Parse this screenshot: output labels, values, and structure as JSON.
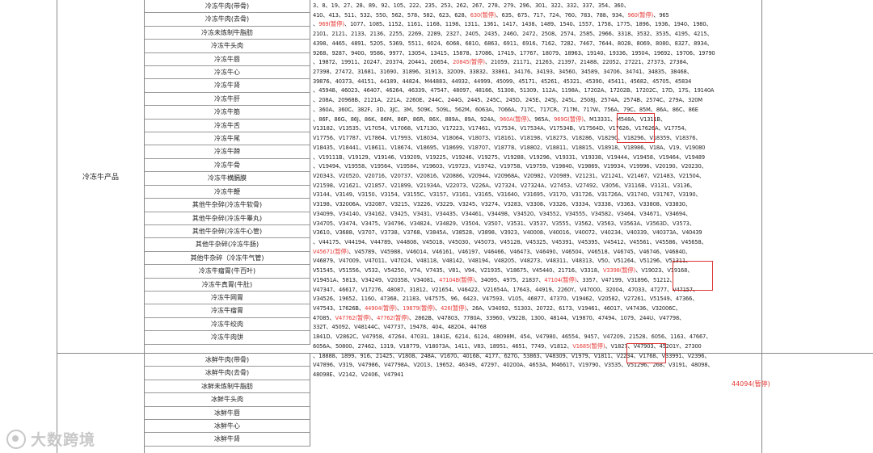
{
  "frozen": {
    "category": "冷冻牛产品",
    "items": [
      "冷冻牛肉(带骨)",
      "冷冻牛肉(去骨)",
      "冷冻未炼制牛脂肪",
      "冷冻牛头肉",
      "冷冻牛唇",
      "冷冻牛心",
      "冷冻牛肾",
      "冷冻牛肝",
      "冷冻牛筋",
      "冷冻牛舌",
      "冷冻牛尾",
      "冷冻牛蹄",
      "冷冻牛骨",
      "冷冻牛横膈膜",
      "冷冻牛鞭",
      "其他牛杂碎(冷冻牛软骨)",
      "其他牛杂碎(冷冻牛睾丸)",
      "其他牛杂碎(冷冻牛心管)",
      "其他牛杂碎(冷冻牛肠)",
      "其他牛杂碎（冷冻牛气管)",
      "冷冻牛瘤胃(牛百叶)",
      "冷冻牛真胃(牛肚)",
      "冷冻牛网胃",
      "冷冻牛瘤胃",
      "冷冻牛绞肉",
      "冷冻牛肉饼"
    ]
  },
  "fresh": {
    "items": [
      "冰鲜牛肉(带骨)",
      "冰鲜牛肉(去骨)",
      "冰鲜未炼制牛脂肪",
      "冰鲜牛头肉",
      "冰鲜牛唇",
      "冰鲜牛心",
      "冰鲜牛肾"
    ]
  },
  "codes_lines": [
    [
      {
        "t": "3、8、19、27、28、89、92、105、222、235、253、262、267、278、279、296、301、322、332、337、354、360、"
      }
    ],
    [
      {
        "t": "410、413、511、532、550、562、578、582、623、628、"
      },
      {
        "t": "630(暂停)",
        "r": 1
      },
      {
        "t": "、635、675、717、724、760、783、788、934、"
      },
      {
        "t": "960(暂停)",
        "r": 1
      },
      {
        "t": "、965"
      }
    ],
    [
      {
        "t": "、"
      },
      {
        "t": "969(暂停)",
        "r": 1
      },
      {
        "t": "、1077、1085、1152、1161、1168、1198、1311、1361、1417、1438、1489、1540、1557、1758、1775、1896、1936、1940、1980、"
      }
    ],
    [
      {
        "t": "2101、2121、2133、2136、2255、2269、2289、2327、2405、2435、2460、2472、2508、2574、2585、2966、3318、3532、3535、4195、4215、"
      }
    ],
    [
      {
        "t": "4398、4465、4891、5205、5369、5511、6024、6068、6810、6863、6911、6916、7162、7282、7467、7644、8028、8069、8080、8327、8934、"
      }
    ],
    [
      {
        "t": "9268、9287、9400、9586、9977、13054、13415、15878、17086、17419、17767、18079、18963、19140、19336、19504、19692、19706、19790"
      }
    ],
    [
      {
        "t": "、19872、19911、20247、20374、20441、20654、"
      },
      {
        "t": "20845(暂停)",
        "r": 1
      },
      {
        "t": "、21059、21171、21263、21397、21488、22052、27221、27373、27384、"
      }
    ],
    [
      {
        "t": "27398、27472、31681、31690、31896、31913、32009、33832、33861、34176、34193、34560、34589、34706、34741、34835、38468、"
      }
    ],
    [
      {
        "t": "39876、40373、44151、44189、44824、M44883、44932、44999、45099、45171、45261、45321、45390、45411、45682、45705、45834"
      }
    ],
    [
      {
        "t": "、45948、46023、46407、46264、46339、47547、48097、48166、51308、51309、112A、1198A、17202A、17202B、17202C、17D、17S、19140A"
      }
    ],
    [
      {
        "t": "、208A、20968B、2121A、221A、2260E、244C、244G、2445、245C、245D、245E、245J、245L、2508J、2574A、2574B、2574C、279A、320M"
      }
    ],
    [
      {
        "t": "、360A、360C、382F、3D、3JC、3M、509K、509L、562M、6063A、7066A、717C、717CR、717M、717W、756A、79C、85M、86A、86C、86E"
      }
    ],
    [
      {
        "t": "、86F、86G、86J、86K、86M、86P、86R、86X、889A、89A、924A、"
      },
      {
        "t": "960A(暂停)",
        "r": 1
      },
      {
        "t": "、965A、"
      },
      {
        "t": "969G(暂停)",
        "r": 1
      },
      {
        "t": "、M13331、M548A、V1311B、"
      }
    ],
    [
      {
        "t": "V13182、V13535、V17054、V17068、V17130、V17223、V17461、V17534、V17534A、V17534B、V17564D、V17626、V17626A、V17754、"
      }
    ],
    [
      {
        "t": "V17756、V17787、V17864、V17993、V18034、V18064、V18073、V18161、V18198、V18273、V18286、V18290、V18296、V18359、V18376、"
      }
    ],
    [
      {
        "t": "V18435、V18441、V18611、V18674、V18695、V18699、V18707、V18778、V18802、V18811、V18815、V18918、V18986、V18A、V19、V19080"
      }
    ],
    [
      {
        "t": "、V19111B、V19129、V19146、V19209、V19225、V19246、V19275、V19288、V19296、V19331、V19338、V19444、V19458、V19464、V19489"
      }
    ],
    [
      {
        "t": "、V19494、V19558、V19564、V19584、V19603、V19723、V19742、V19758、V19759、V19840、V19869、V19934、V19996、V20190、V20230、"
      }
    ],
    [
      {
        "t": "V20343、V20520、V20716、V20737、V20816、V20886、V20944、V20968A、V20982、V20989、V21231、V21241、V21467、V21483、V21504、"
      }
    ],
    [
      {
        "t": "V21598、V21621、V21857、V21899、V21934A、V22073、V226A、V27324、V27324A、V27453、V27492、V3056、V3116B、V3131、V3136、"
      }
    ],
    [
      {
        "t": "V3144、V3149、V3150、V3154、V3155C、V3157、V3161、V3165、V31640、V31695、V3170、V31726、V31726A、V31740、V31767、V3190、"
      }
    ],
    [
      {
        "t": "V3198、V32006A、V32087、V3215、V3226、V3229、V3245、V3274、V3283、V3308、V3326、V3334、V3338、V3363、V33808、V33830、"
      }
    ],
    [
      {
        "t": "V34099、V34140、V34162、V3425、V3431、V34435、V34461、V34498、V34520、V34552、V34555、V34582、V3464、V34671、V34694、"
      }
    ],
    [
      {
        "t": "V34705、V3474、V3475、V34796、V34824、V34829、V3504、V3507、V3531、V3537、V3555、V3562、V3563、V3563A、V3563D、V3573、"
      }
    ],
    [
      {
        "t": "V3610、V3688、V3707、V3738、V3768、V3845A、V38528、V3898、V3923、V40008、V40016、V40072、V40234、V40339、V40373A、V40439"
      }
    ],
    [
      {
        "t": "、V44175、V44194、V44789、V44808、V45018、V45030、V45073、V45128、V45325、V45391、V45395、V45412、V45561、V45586、V45658、"
      }
    ],
    [
      {
        "t": "V45671(暂停)",
        "r": 1
      },
      {
        "t": "、V45789、V45988、V46014、V46161、V46197、V46466、V46473、V46490、V46504、V46518、V46745、V46746、V46840、"
      }
    ],
    [
      {
        "t": "V46879、V47009、V47011、V47024、V48118、V48142、V48194、V48205、V48273、V48311、V48313、V50、V51264、V51296、V51311、"
      }
    ],
    [
      {
        "t": "V51545、V51556、V532、V54250、V74、V7435、V81、V94、V21935、V18675、V45440、21716、V3318、"
      },
      {
        "t": "V3398(暂停)",
        "r": 1
      },
      {
        "t": "、V19023、V19168、"
      }
    ],
    [
      {
        "t": "V19451A、5813、V34249、V20358、V34081、"
      },
      {
        "t": "47104B(暂停)",
        "r": 1
      },
      {
        "t": "、34095、4975、21837、"
      },
      {
        "t": "47104(暂停)",
        "r": 1
      },
      {
        "t": "、3357、V47199、V31896、51212、"
      }
    ],
    [
      {
        "t": "V47347、46617、V17276、48087、31812、V21654、V46422、V21654A、17643、44919、2260Y、V47000、32004、47033、47277、V47157、"
      }
    ],
    [
      {
        "t": "V34526、19652、1160、47368、21183、V47575、96、6423、V47593、V105、46877、47370、V19462、V20582、V27261、V51549、47366、"
      }
    ],
    [
      {
        "t": "V47543、17626B、"
      },
      {
        "t": "44904(暂停)",
        "r": 1
      },
      {
        "t": "、"
      },
      {
        "t": "19879(暂停)",
        "r": 1
      },
      {
        "t": "、"
      },
      {
        "t": "426(暂停)",
        "r": 1
      },
      {
        "t": "、26A、V34092、51303、20722、6173、V19461、46017、V47436、V32006C、"
      }
    ],
    [
      {
        "t": "47085、"
      },
      {
        "t": "V47762(暂停)",
        "r": 1
      },
      {
        "t": "、"
      },
      {
        "t": "47762(暂停)",
        "r": 1
      },
      {
        "t": "、2862B、V47803、7780A、33960、V9228、1300、48144、V19870、47494、1079、244U、V47798、"
      }
    ],
    [
      {
        "t": "332T、45092、V48144C、V47737、19478、404、48204、44768"
      }
    ],
    [
      {
        "t": "1841D、V2862C、V47958、47264、47031、1841E、6214、6124、48098M、454、V47980、46554、9457、V47209、21528、6056、1163、47667、"
      }
    ],
    [
      {
        "t": "6056A、50800、27462、1319、V18779、V18073A、1411、V83、18951、4651、7749、V1812、"
      },
      {
        "t": "V1685(暂停)",
        "r": 1
      },
      {
        "t": "、V1827、V47903、45201Y、27300"
      }
    ],
    [
      {
        "t": "、18888、1899、916、21425、V1808、248A、V1670、40168、4177、6270、53863、V48309、V1979、V1811、V2234、V1768、V33991、V2396、"
      }
    ],
    [
      {
        "t": "V47896、V319、V47986、V47798A、V2013、19652、46349、47297、40200A、4653A、M46617、V19790、V3535、V51296、268、V3191、48098、"
      }
    ],
    [
      {
        "t": "48098E、V2142、V2406、V47941"
      }
    ]
  ],
  "fresh_note": "44094(暂停)",
  "watermark": "大数跨境"
}
